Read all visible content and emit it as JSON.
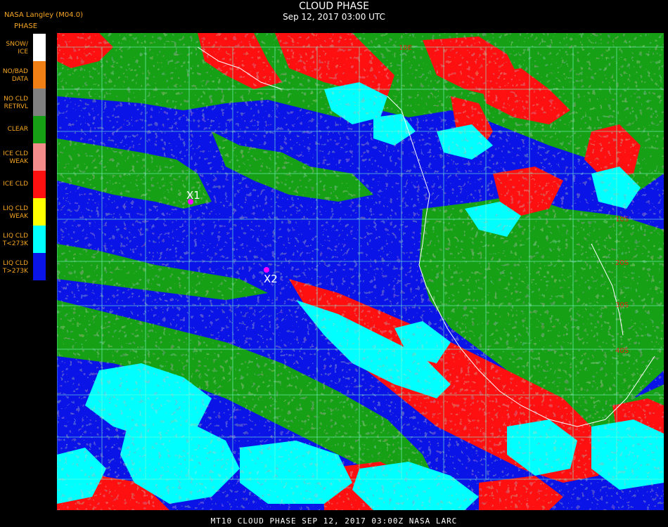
{
  "header": {
    "source": "NASA Langley (M04.0)",
    "legend_title": "PHASE",
    "title": "CLOUD PHASE",
    "subtitle": "Sep 12, 2017 03:00 UTC"
  },
  "legend": {
    "items": [
      {
        "label": "SNOW/\nICE",
        "color": "#ffffff"
      },
      {
        "label": "NO/BAD\nDATA",
        "color": "#f07f16"
      },
      {
        "label": "NO CLD\nRETRVL",
        "color": "#808080"
      },
      {
        "label": "CLEAR",
        "color": "#16a016"
      },
      {
        "label": "ICE CLD\nWEAK",
        "color": "#f48c8c"
      },
      {
        "label": "ICE CLD",
        "color": "#ff1010"
      },
      {
        "label": "LIQ CLD\nWEAK",
        "color": "#ffff00"
      },
      {
        "label": "LIQ CLD\nT<273K",
        "color": "#00ffff"
      },
      {
        "label": "LIQ CLD\nT>273K",
        "color": "#0a14e6"
      }
    ]
  },
  "map": {
    "markers": [
      {
        "label": "X1",
        "color": "#ff00ff"
      },
      {
        "label": "X2",
        "color": "#ff00ff"
      }
    ],
    "grid_labels": [
      "10E",
      "10S",
      "20S",
      "30S",
      "40S"
    ],
    "grid_color": "#7fffd4",
    "colors": {
      "ocean_liq": "#0a14e6",
      "clear": "#16a016",
      "ice": "#ff1010",
      "liq_cold": "#00ffff",
      "coast": "#ffffff"
    }
  },
  "footer": {
    "text": "MT10  CLOUD PHASE   SEP 12, 2017 03:00Z   NASA LARC"
  }
}
